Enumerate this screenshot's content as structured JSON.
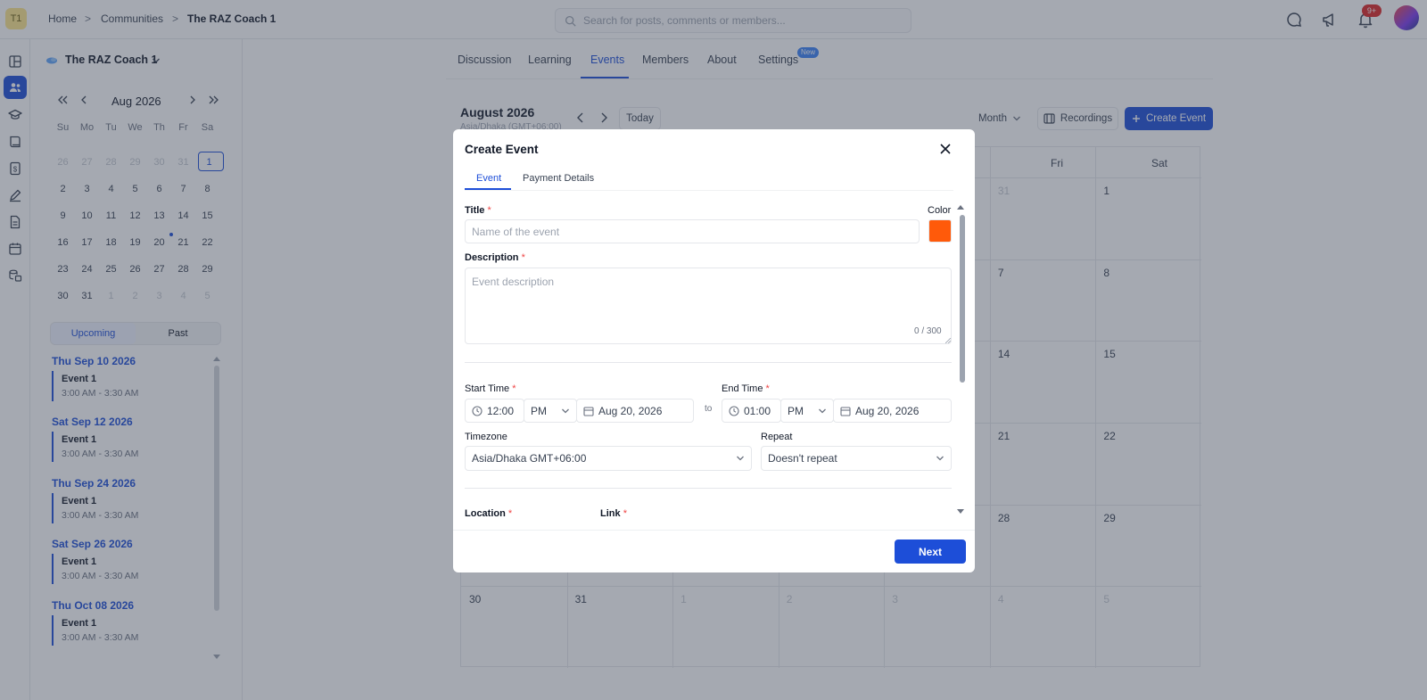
{
  "header": {
    "workspace_initials": "T1",
    "breadcrumb": [
      "Home",
      ">",
      "Communities",
      ">",
      "The RAZ Coach 1"
    ],
    "search_placeholder": "Search for posts, comments or members...",
    "notif_badge": "9+"
  },
  "sidebar": {
    "community_name": "The RAZ Coach 1",
    "calendar": {
      "month_label": "Aug 2026",
      "weekdays": [
        "Su",
        "Mo",
        "Tu",
        "We",
        "Th",
        "Fr",
        "Sa"
      ],
      "weeks": [
        [
          "26",
          "27",
          "28",
          "29",
          "30",
          "31",
          "1"
        ],
        [
          "2",
          "3",
          "4",
          "5",
          "6",
          "7",
          "8"
        ],
        [
          "9",
          "10",
          "11",
          "12",
          "13",
          "14",
          "15"
        ],
        [
          "16",
          "17",
          "18",
          "19",
          "20",
          "21",
          "22"
        ],
        [
          "23",
          "24",
          "25",
          "26",
          "27",
          "28",
          "29"
        ],
        [
          "30",
          "31",
          "1",
          "2",
          "3",
          "4",
          "5"
        ]
      ]
    },
    "segment": {
      "upcoming": "Upcoming",
      "past": "Past"
    },
    "events": [
      {
        "date": "Thu Sep 10 2026",
        "title": "Event 1",
        "time": "3:00 AM - 3:30 AM"
      },
      {
        "date": "Sat Sep 12 2026",
        "title": "Event 1",
        "time": "3:00 AM - 3:30 AM"
      },
      {
        "date": "Thu Sep 24 2026",
        "title": "Event 1",
        "time": "3:00 AM - 3:30 AM"
      },
      {
        "date": "Sat Sep 26 2026",
        "title": "Event 1",
        "time": "3:00 AM - 3:30 AM"
      },
      {
        "date": "Thu Oct 08 2026",
        "title": "Event 1",
        "time": "3:00 AM - 3:30 AM"
      }
    ]
  },
  "main": {
    "tabs": [
      "Discussion",
      "Learning",
      "Events",
      "Members",
      "About",
      "Settings"
    ],
    "active_tab": "Events",
    "settings_badge": "New",
    "calendar_title": "August 2026",
    "timezone_label": "Asia/Dhaka (GMT+06:00)",
    "today_label": "Today",
    "view_select": "Month",
    "recordings_label": "Recordings",
    "create_event_label": "Create Event",
    "visible_weekdays": [
      "Fri",
      "Sat"
    ],
    "grid_rows": [
      [
        "",
        "",
        "",
        "",
        "",
        "31",
        "1"
      ],
      [
        "",
        "",
        "",
        "",
        "",
        "7",
        "8"
      ],
      [
        "",
        "",
        "",
        "",
        "",
        "14",
        "15"
      ],
      [
        "",
        "",
        "",
        "",
        "",
        "21",
        "22"
      ],
      [
        "",
        "",
        "",
        "",
        "",
        "28",
        "29"
      ],
      [
        "30",
        "31",
        "1",
        "2",
        "3",
        "4",
        "5"
      ]
    ]
  },
  "modal": {
    "title": "Create Event",
    "tabs": {
      "event": "Event",
      "payment": "Payment Details"
    },
    "title_label": "Title",
    "title_placeholder": "Name of the event",
    "color_label": "Color",
    "color_value": "#ff5a0a",
    "description_label": "Description",
    "description_placeholder": "Event description",
    "char_count": "0 / 300",
    "start_time_label": "Start Time",
    "start_time": "12:00",
    "start_ampm": "PM",
    "start_date": "Aug 20, 2026",
    "to_label": "to",
    "end_time_label": "End Time",
    "end_time": "01:00",
    "end_ampm": "PM",
    "end_date": "Aug 20, 2026",
    "timezone_label": "Timezone",
    "timezone_value": "Asia/Dhaka GMT+06:00",
    "repeat_label": "Repeat",
    "repeat_value": "Doesn't repeat",
    "location_label": "Location",
    "link_label": "Link",
    "required_mark": "*",
    "next_label": "Next"
  },
  "colors": {
    "accent": "#1d4ed8",
    "danger": "#ef4444",
    "event_color": "#ff5a0a"
  }
}
